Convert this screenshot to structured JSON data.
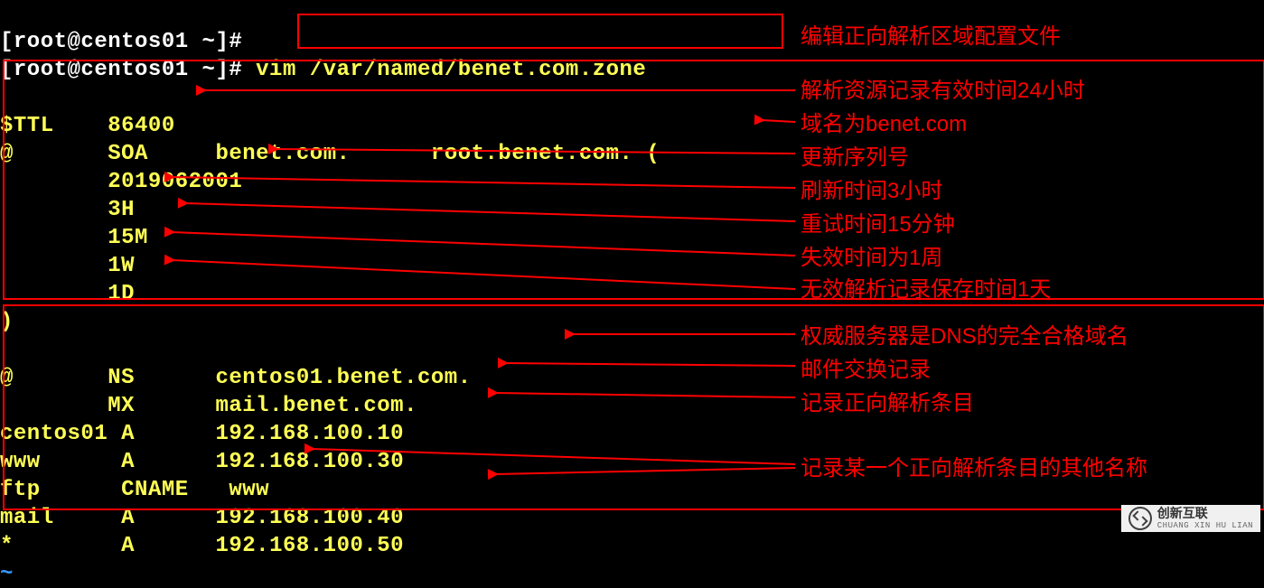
{
  "prompt_line_prev": "[root@centos01 ~]#",
  "prompt_line": "[root@centos01 ~]# ",
  "command": "vim /var/named/benet.com.zone",
  "zone": {
    "ttl_label": "$TTL",
    "ttl_value": "86400",
    "origin": "@",
    "soa_label": "SOA",
    "soa_primary": "benet.com.",
    "soa_contact": "root.benet.com.",
    "soa_open": "(",
    "serial": "2019062001",
    "refresh": "3H",
    "retry": "15M",
    "expire": "1W",
    "minimum": "1D",
    "close": ")",
    "records": {
      "ns": {
        "owner": "@",
        "type": "NS",
        "value": "centos01.benet.com."
      },
      "mx": {
        "owner": "",
        "type": "MX",
        "value": "mail.benet.com."
      },
      "a1": {
        "owner": "centos01",
        "type": "A",
        "value": "192.168.100.10"
      },
      "a2": {
        "owner": "www",
        "type": "A",
        "value": "192.168.100.30"
      },
      "cname": {
        "owner": "ftp",
        "type": "CNAME",
        "value": "www"
      },
      "a3": {
        "owner": "mail",
        "type": "A",
        "value": "192.168.100.40"
      },
      "a4": {
        "owner": "*",
        "type": "A",
        "value": "192.168.100.50"
      }
    }
  },
  "tilde": "~",
  "annotations": {
    "cmd": "编辑正向解析区域配置文件",
    "ttl": "解析资源记录有效时间24小时",
    "soa": "域名为benet.com",
    "serial": "更新序列号",
    "refresh": "刷新时间3小时",
    "retry": "重试时间15分钟",
    "expire": "失效时间为1周",
    "minimum": "无效解析记录保存时间1天",
    "ns": "权威服务器是DNS的完全合格域名",
    "mx": "邮件交换记录",
    "a": "记录正向解析条目",
    "cname": "记录某一个正向解析条目的其他名称"
  },
  "watermark": {
    "title": "创新互联",
    "sub": "CHUANG XIN HU LIAN"
  }
}
